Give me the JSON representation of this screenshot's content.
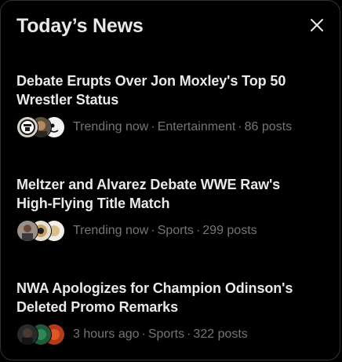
{
  "panel": {
    "title": "Today’s News",
    "close_icon": "close-icon"
  },
  "news": [
    {
      "headline_line1": "Debate Erupts Over Jon Moxley's Top 50",
      "headline_line2": "Wrestler Status",
      "time": "Trending now",
      "category": "Entertainment",
      "posts": "86 posts"
    },
    {
      "headline_line1": "Meltzer and Alvarez Debate WWE Raw's",
      "headline_line2": "High-Flying Title Match",
      "time": "Trending now",
      "category": "Sports",
      "posts": "299 posts"
    },
    {
      "headline_line1": "NWA Apologizes for Champion Odinson's",
      "headline_line2": "Deleted Promo Remarks",
      "time": "3 hours ago",
      "category": "Sports",
      "posts": "322 posts"
    }
  ],
  "separator": "·",
  "colors": {
    "background": "#000000",
    "text_primary": "#e7e9ea",
    "text_secondary": "#71767b",
    "border": "#2f3336"
  }
}
